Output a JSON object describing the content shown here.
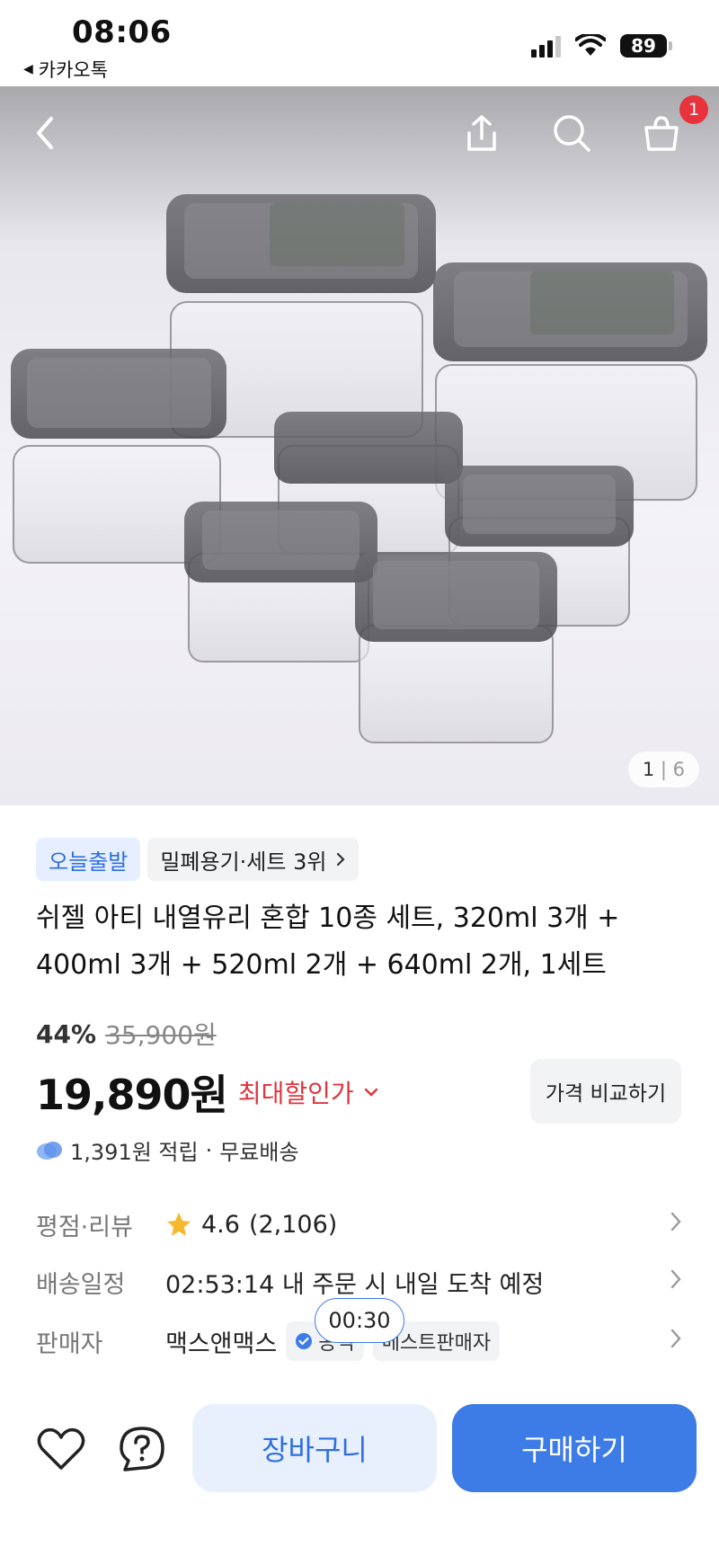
{
  "status_bar": {
    "time": "08:06",
    "back_app": "카카오톡",
    "battery": "89"
  },
  "hero": {
    "page_current": "1",
    "page_total": "6",
    "cart_badge": "1"
  },
  "tags": {
    "today_ship": "오늘출발",
    "rank": "밀폐용기·세트 3위"
  },
  "product": {
    "title": "쉬젤 아티 내열유리 혼합 10종 세트, 320ml 3개 + 400ml 3개 + 520ml 2개 + 640ml 2개, 1세트",
    "discount": "44%",
    "original_price": "35,900원",
    "price": "19,890원",
    "max_discount": "최대할인가",
    "compare_button": "가격 비교하기",
    "points": "1,391원 적립",
    "shipping": "무료배송",
    "points_sep": "·"
  },
  "info": {
    "rating_label": "평점·리뷰",
    "rating": "4.6",
    "review_count": "(2,106)",
    "delivery_label": "배송일정",
    "delivery_text": "02:53:14 내 주문 시 내일 도착 예정",
    "seller_label": "판매자",
    "seller_name": "맥스앤맥스",
    "seller_badge": "공식",
    "best_seller": "베스트판매자",
    "timer": "00:30"
  },
  "bottom": {
    "cart_button": "장바구니",
    "buy_button": "구매하기"
  },
  "colors": {
    "primary": "#3d7be6",
    "discount_red": "#e0343c",
    "badge_red": "#e8323c"
  }
}
